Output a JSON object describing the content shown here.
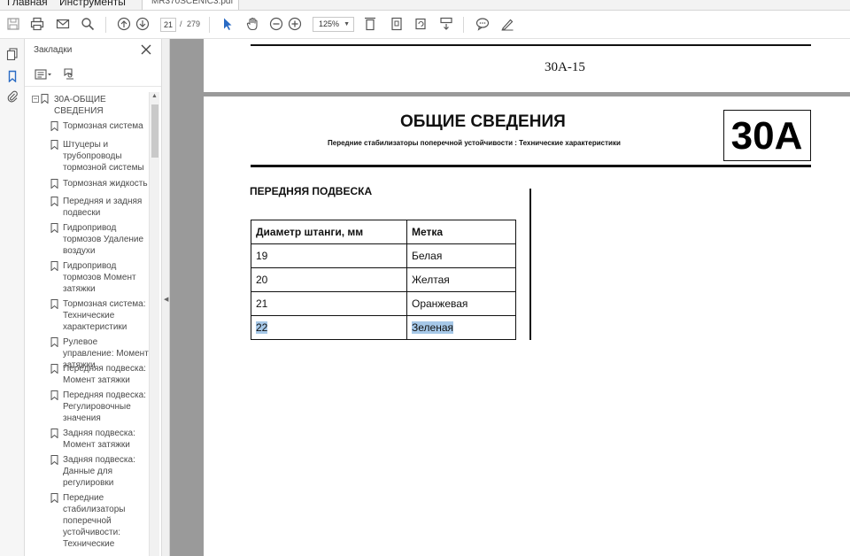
{
  "menubar": {
    "home": "Главная",
    "tools": "Инструменты",
    "file_tab": "MR370SCENIC3.pdf"
  },
  "toolbar": {
    "current_page": "21",
    "page_separator": "/",
    "total_pages": "279",
    "zoom": "125%",
    "icons": [
      "save-icon",
      "print-icon",
      "mail-icon",
      "search-icon",
      "page-up-icon",
      "page-down-icon",
      "select-arrow-icon",
      "hand-icon",
      "zoom-out-icon",
      "zoom-in-icon",
      "fit-width-icon",
      "fit-page-icon",
      "scroll-mode-icon",
      "comment-icon",
      "sign-icon"
    ]
  },
  "bookmarks": {
    "header": "Закладки",
    "items": [
      {
        "label": "30A-ОБЩИЕ СВЕДЕНИЯ",
        "root": true
      },
      {
        "label": "Тормозная система"
      },
      {
        "label": "Штуцеры и трубопроводы тормозной системы"
      },
      {
        "label": "Тормозная жидкость"
      },
      {
        "label": "Передняя и задняя подвески"
      },
      {
        "label": "Гидропривод тормозов Удаление воздухи"
      },
      {
        "label": "Гидропривод тормозов Момент затяжки"
      },
      {
        "label": "Тормозная система: Технические характеристики"
      },
      {
        "label": "Рулевое управление: Момент затяжки"
      },
      {
        "label": "Передняя подвеска: Момент затяжки"
      },
      {
        "label": "Передняя подвеска: Регулировочные значения"
      },
      {
        "label": "Задняя подвеска: Момент затяжки"
      },
      {
        "label": "Задняя подвеска: Данные для регулировки"
      },
      {
        "label": "Передние стабилизаторы поперечной устойчивости: Технические"
      }
    ]
  },
  "document": {
    "page_number": "30A-15",
    "section_title": "ОБЩИЕ СВЕДЕНИЯ",
    "section_subtitle": "Передние стабилизаторы поперечной устойчивости : Технические характеристики",
    "chapter_code": "30A",
    "front_suspension_title": "ПЕРЕДНЯЯ ПОДВЕСКА",
    "table": {
      "headers": [
        "Диаметр штанги, мм",
        "Метка"
      ],
      "rows": [
        [
          "19",
          "Белая"
        ],
        [
          "20",
          "Желтая"
        ],
        [
          "21",
          "Оранжевая"
        ],
        [
          "22",
          "Зеленая"
        ]
      ]
    }
  },
  "colors": {
    "selection": "#a6c8e8",
    "accent_blue": "#2a6bc4",
    "viewer_gray": "#9a9a9a"
  }
}
